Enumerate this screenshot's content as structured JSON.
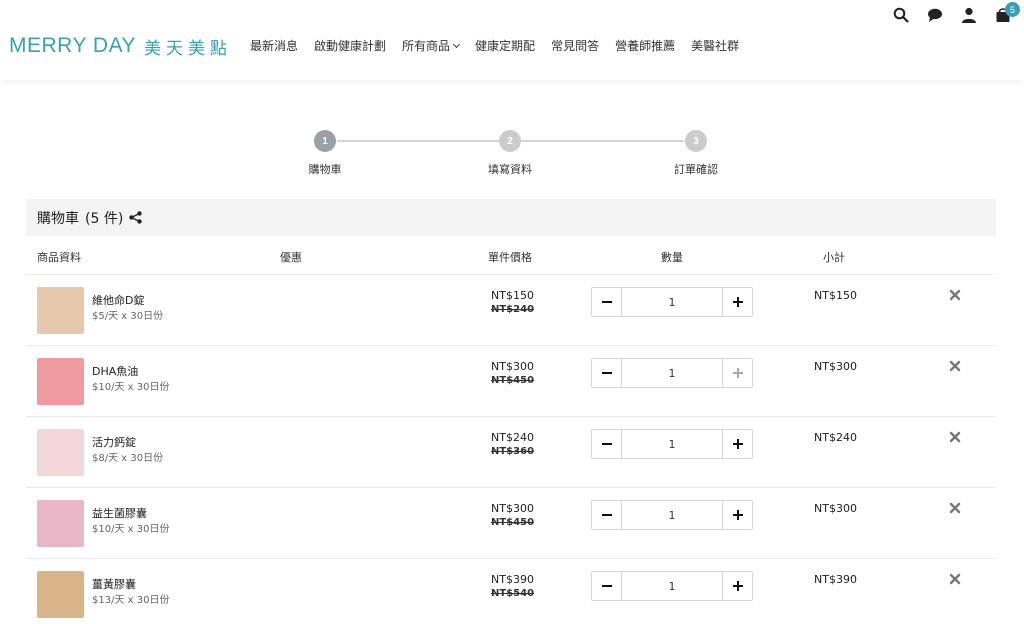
{
  "brand": {
    "name_en": "MERRY DAY",
    "name_zh": "美天美點",
    "color": "#3aa0b1"
  },
  "nav": [
    {
      "label": "最新消息"
    },
    {
      "label": "啟動健康計劃"
    },
    {
      "label": "所有商品"
    },
    {
      "label": "健康定期配"
    },
    {
      "label": "常見問答"
    },
    {
      "label": "營養師推薦"
    },
    {
      "label": "美醫社群"
    }
  ],
  "header_icons": {
    "search": "search-icon",
    "chat": "chat-icon",
    "user": "user-icon",
    "cart": "cart-icon",
    "cart_count": "5"
  },
  "steps": [
    {
      "num": "1",
      "label": "購物車"
    },
    {
      "num": "2",
      "label": "填寫資料"
    },
    {
      "num": "3",
      "label": "訂單確認"
    }
  ],
  "cart": {
    "title": "購物車",
    "count": "(5 件)",
    "columns": {
      "product": "商品資料",
      "discount": "優惠",
      "unit_price": "單件價格",
      "qty": "數量",
      "subtotal": "小計"
    },
    "items": [
      {
        "name": "維他命D錠",
        "dose": "$5/天 x 30日份",
        "price": "NT$150",
        "orig": "NT$240",
        "qty": "1",
        "subtotal": "NT$150",
        "thumb_color": "#e6c9ad"
      },
      {
        "name": "DHA魚油",
        "dose": "$10/天 x 30日份",
        "price": "NT$300",
        "orig": "NT$450",
        "qty": "1",
        "subtotal": "NT$300",
        "thumb_color": "#ef9aa0"
      },
      {
        "name": "活力鈣錠",
        "dose": "$8/天 x 30日份",
        "price": "NT$240",
        "orig": "NT$360",
        "qty": "1",
        "subtotal": "NT$240",
        "thumb_color": "#f2d8d6"
      },
      {
        "name": "益生菌膠囊",
        "dose": "$10/天 x 30日份",
        "price": "NT$300",
        "orig": "NT$450",
        "qty": "1",
        "subtotal": "NT$300",
        "thumb_color": "#e9b7c8"
      },
      {
        "name": "薑黃膠囊",
        "dose": "$13/天 x 30日份",
        "price": "NT$390",
        "orig": "NT$540",
        "qty": "1",
        "subtotal": "NT$390",
        "thumb_color": "#d9b48a"
      }
    ]
  }
}
